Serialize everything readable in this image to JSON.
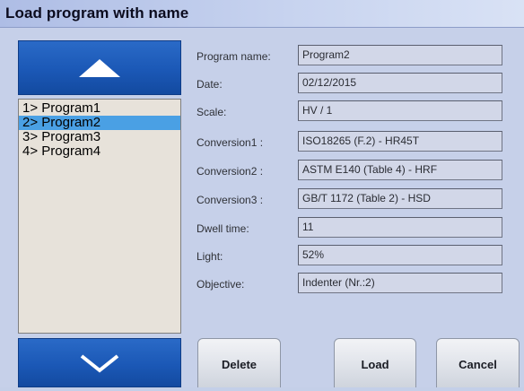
{
  "window": {
    "title": "Load program with name"
  },
  "programs": {
    "items": [
      {
        "label": "1> Program1"
      },
      {
        "label": "2> Program2"
      },
      {
        "label": "3> Program3"
      },
      {
        "label": "4> Program4"
      }
    ],
    "selected_label": "2> Program2"
  },
  "details": {
    "program_name": {
      "label": "Program name:",
      "value": "Program2"
    },
    "date": {
      "label": "Date:",
      "value": "02/12/2015"
    },
    "scale": {
      "label": "Scale:",
      "value": "HV / 1"
    },
    "conversion1": {
      "label": "Conversion1 :",
      "value": "ISO18265 (F.2) - HR45T"
    },
    "conversion2": {
      "label": "Conversion2 :",
      "value": "ASTM E140 (Table 4) - HRF"
    },
    "conversion3": {
      "label": "Conversion3 :",
      "value": "GB/T 1172 (Table 2) - HSD"
    },
    "dwell_time": {
      "label": "Dwell time:",
      "value": "11"
    },
    "light": {
      "label": "Light:",
      "value": "52%"
    },
    "objective": {
      "label": "Objective:",
      "value": "Indenter (Nr.:2)"
    }
  },
  "buttons": {
    "delete": "Delete",
    "load": "Load",
    "cancel": "Cancel"
  },
  "icons": {
    "scroll_up": "triangle-up-icon",
    "scroll_down": "chevron-down-icon"
  },
  "colors": {
    "accent_blue": "#1b58b6",
    "selection": "#4aa0e4",
    "background": "#c6d0e9"
  }
}
